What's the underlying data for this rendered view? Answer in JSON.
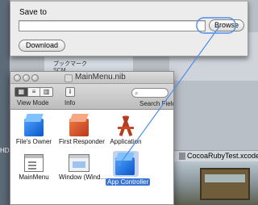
{
  "sheet": {
    "save_label": "Save to",
    "path_value": "",
    "browse_label": "Browse",
    "download_label": "Download"
  },
  "background": {
    "sidebar_items": [
      "ブックマーク",
      "SCM"
    ],
    "left_label": "HD",
    "tab_label": "CocoaRubyTest.xcodep"
  },
  "nib": {
    "title": "MainMenu.nib",
    "view_mode_label": "View Mode",
    "info_label": "Info",
    "info_glyph": "i",
    "search_label": "Search Field",
    "items": [
      {
        "label": "File's Owner",
        "icon": "blue-cube-icon"
      },
      {
        "label": "First Responder",
        "icon": "orange-cube-icon"
      },
      {
        "label": "Application",
        "icon": "app-a-icon"
      },
      {
        "label": "MainMenu",
        "icon": "menu-icon"
      },
      {
        "label": "Window (Wind...",
        "icon": "window-icon"
      },
      {
        "label": "App Controller",
        "icon": "blue-cube-icon",
        "selected": true
      }
    ]
  },
  "colors": {
    "selection": "#3875d7",
    "connection_line": "#4f8fe8"
  }
}
